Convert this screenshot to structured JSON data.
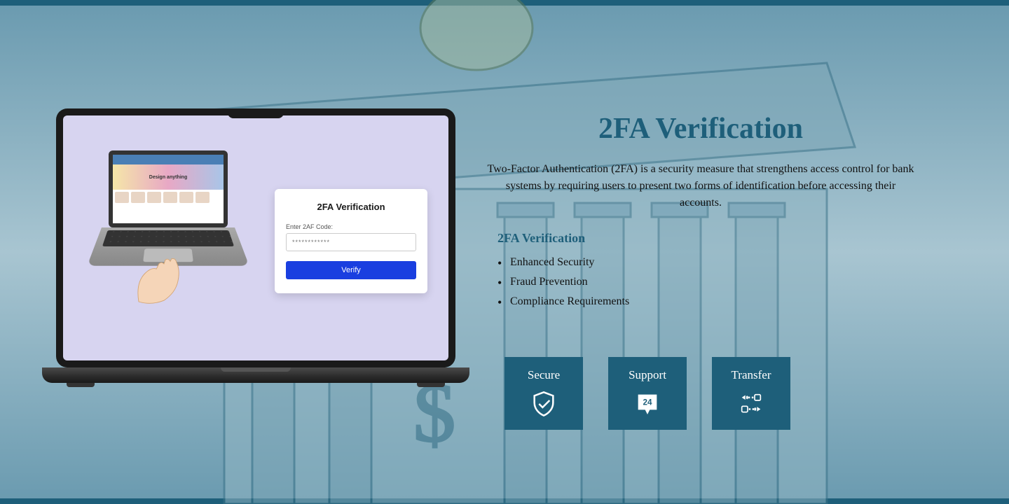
{
  "card": {
    "title": "2FA Verification",
    "label": "Enter 2AF Code:",
    "placeholder": "************",
    "button": "Verify"
  },
  "mini_banner": "Design anything",
  "content": {
    "headline": "2FA Verification",
    "description": "Two-Factor Authentication (2FA) is a security measure that strengthens access control for bank systems by requiring users to present two forms of identification before accessing their accounts.",
    "subhead": "2FA Verification",
    "bullets": [
      "Enhanced Security",
      "Fraud Prevention",
      "Compliance Requirements"
    ]
  },
  "tiles": [
    {
      "label": "Secure"
    },
    {
      "label": "Support"
    },
    {
      "label": "Transfer"
    }
  ]
}
